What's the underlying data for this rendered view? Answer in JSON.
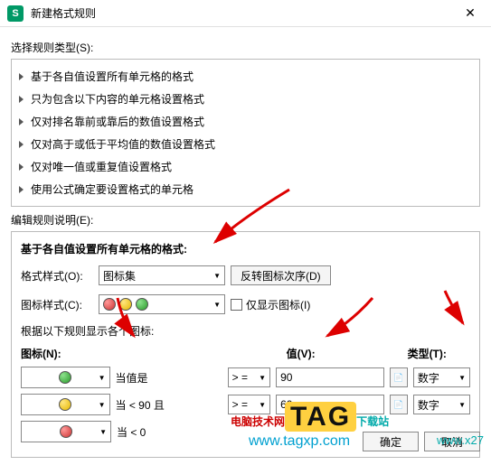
{
  "titlebar": {
    "app_badge": "S",
    "title": "新建格式规则"
  },
  "sections": {
    "select_type": "选择规则类型(S):",
    "edit_desc": "编辑规则说明(E):"
  },
  "rules": [
    "基于各自值设置所有单元格的格式",
    "只为包含以下内容的单元格设置格式",
    "仅对排名靠前或靠后的数值设置格式",
    "仅对高于或低于平均值的数值设置格式",
    "仅对唯一值或重复值设置格式",
    "使用公式确定要设置格式的单元格"
  ],
  "panel": {
    "title": "基于各自值设置所有单元格的格式:",
    "format_label": "格式样式(O):",
    "format_value": "图标集",
    "reverse_btn": "反转图标次序(D)",
    "iconstyle_label": "图标样式(C):",
    "showonly_label": "仅显示图标(I)",
    "subtext": "根据以下规则显示各个图标:",
    "headers": {
      "icon": "图标(N):",
      "value": "值(V):",
      "type": "类型(T):"
    },
    "rows": [
      {
        "cond": "当值是",
        "op": "> =",
        "val": "90",
        "type": "数字"
      },
      {
        "cond": "当 < 90 且",
        "op": "> =",
        "val": "60",
        "type": "数字"
      },
      {
        "cond": "当 < 0",
        "op": "",
        "val": "",
        "type": ""
      }
    ]
  },
  "footer": {
    "ok": "确定",
    "cancel": "取消"
  },
  "watermark": {
    "line1a": "电脑技术网",
    "tag": "TAG",
    "tail": "下载站",
    "url": "www.tagxp.com",
    "url2": "www.x27"
  }
}
